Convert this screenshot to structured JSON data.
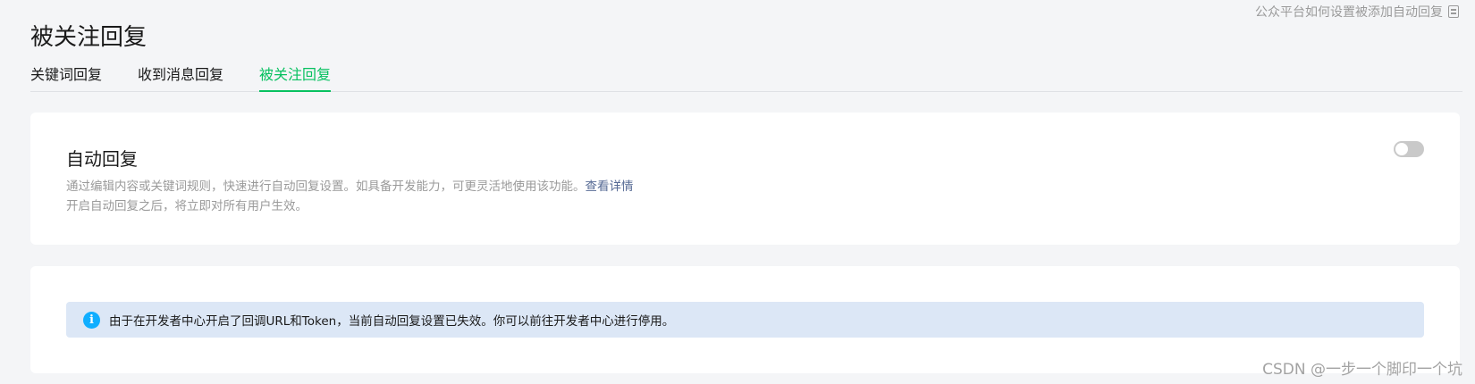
{
  "page": {
    "title": "被关注回复"
  },
  "help": {
    "label": "公众平台如何设置被添加自动回复",
    "icon": "document-icon"
  },
  "tabs": [
    {
      "label": "关键词回复",
      "active": false
    },
    {
      "label": "收到消息回复",
      "active": false
    },
    {
      "label": "被关注回复",
      "active": true
    }
  ],
  "auto_reply": {
    "title": "自动回复",
    "desc_line1": "通过编辑内容或关键词规则，快速进行自动回复设置。如具备开发能力，可更灵活地使用该功能。",
    "detail_link": "查看详情",
    "desc_line2": "开启自动回复之后，将立即对所有用户生效。",
    "toggle_on": false
  },
  "notice": {
    "icon": "info-icon",
    "icon_glyph": "i",
    "text": "由于在开发者中心开启了回调URL和Token，当前自动回复设置已失效。你可以前往开发者中心进行停用。"
  },
  "watermark": "CSDN @一步一个脚印一个坑",
  "colors": {
    "accent": "#07c160",
    "link": "#576b95",
    "info": "#10aeff",
    "notice_bg": "#dce7f6",
    "toggle_off": "#c9c9c9"
  }
}
